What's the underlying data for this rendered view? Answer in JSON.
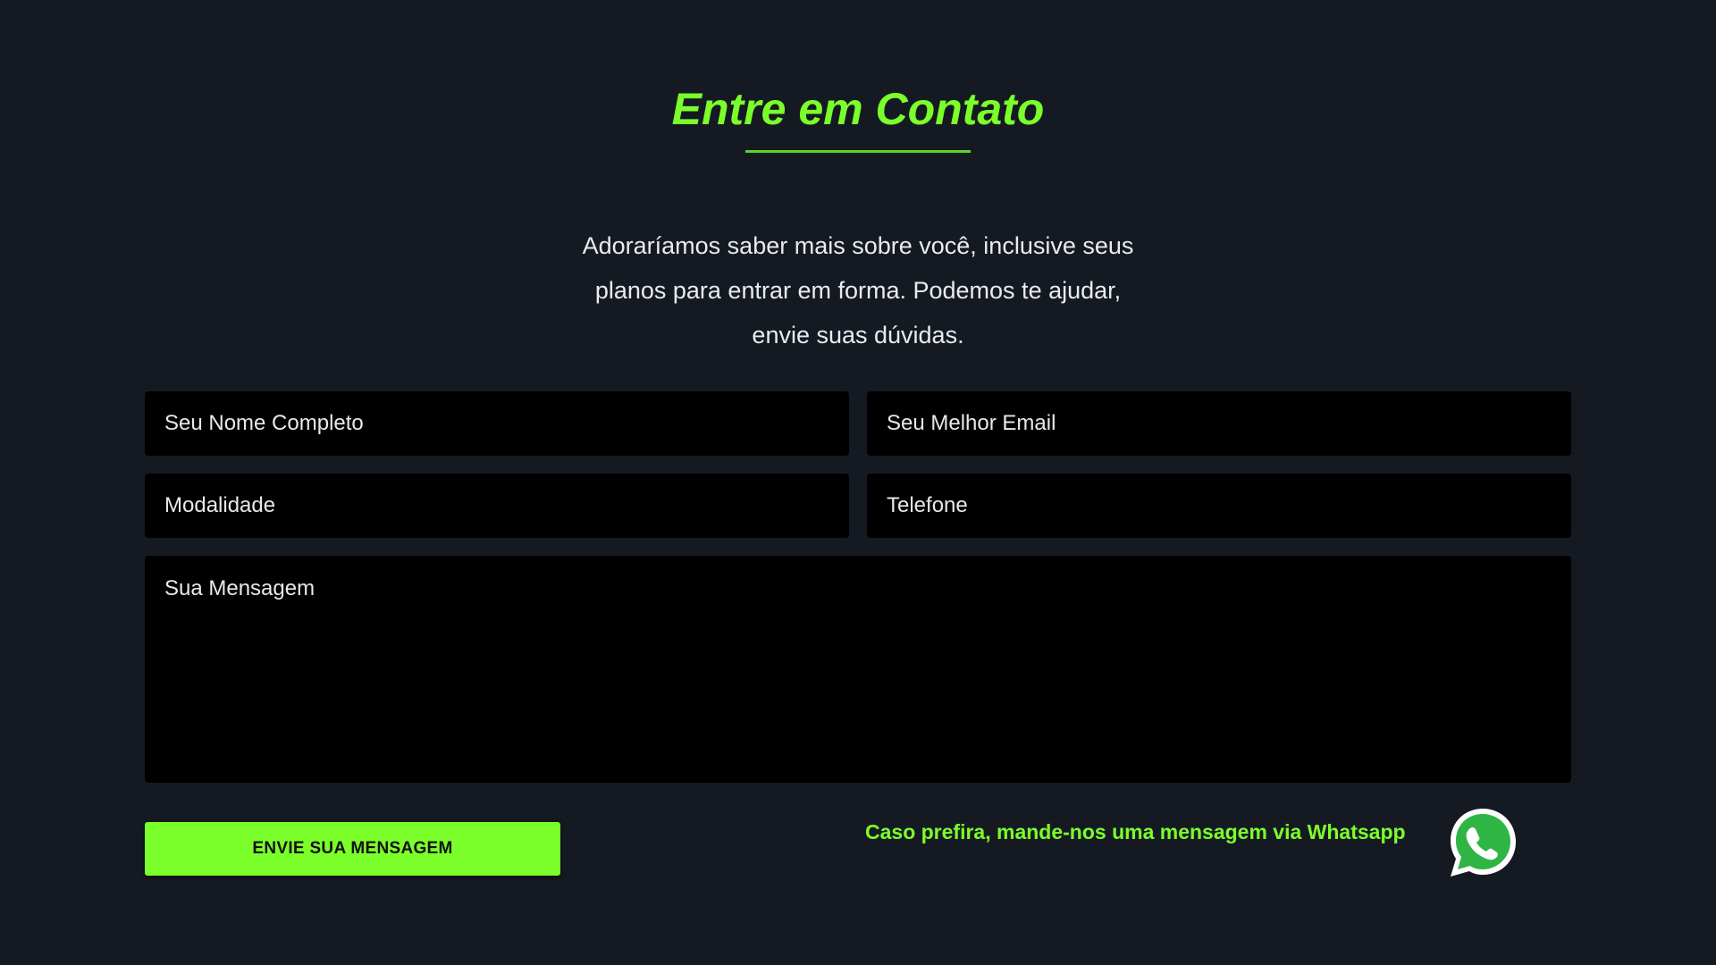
{
  "section": {
    "title": "Entre em Contato",
    "intro": "Adoraríamos saber mais sobre você, inclusive seus planos para entrar em forma. Podemos te ajudar, envie suas dúvidas."
  },
  "form": {
    "name_placeholder": "Seu Nome Completo",
    "email_placeholder": "Seu Melhor Email",
    "modality_placeholder": "Modalidade",
    "phone_placeholder": "Telefone",
    "message_placeholder": "Sua Mensagem",
    "submit_label": "ENVIE SUA MENSAGEM"
  },
  "whatsapp": {
    "text": "Caso prefira, mande-nos uma mensagem via Whatsapp",
    "icon": "whatsapp-icon"
  },
  "colors": {
    "background": "#151a22",
    "accent": "#7bff2b",
    "field_bg": "#000000",
    "text": "#e8ecef"
  }
}
